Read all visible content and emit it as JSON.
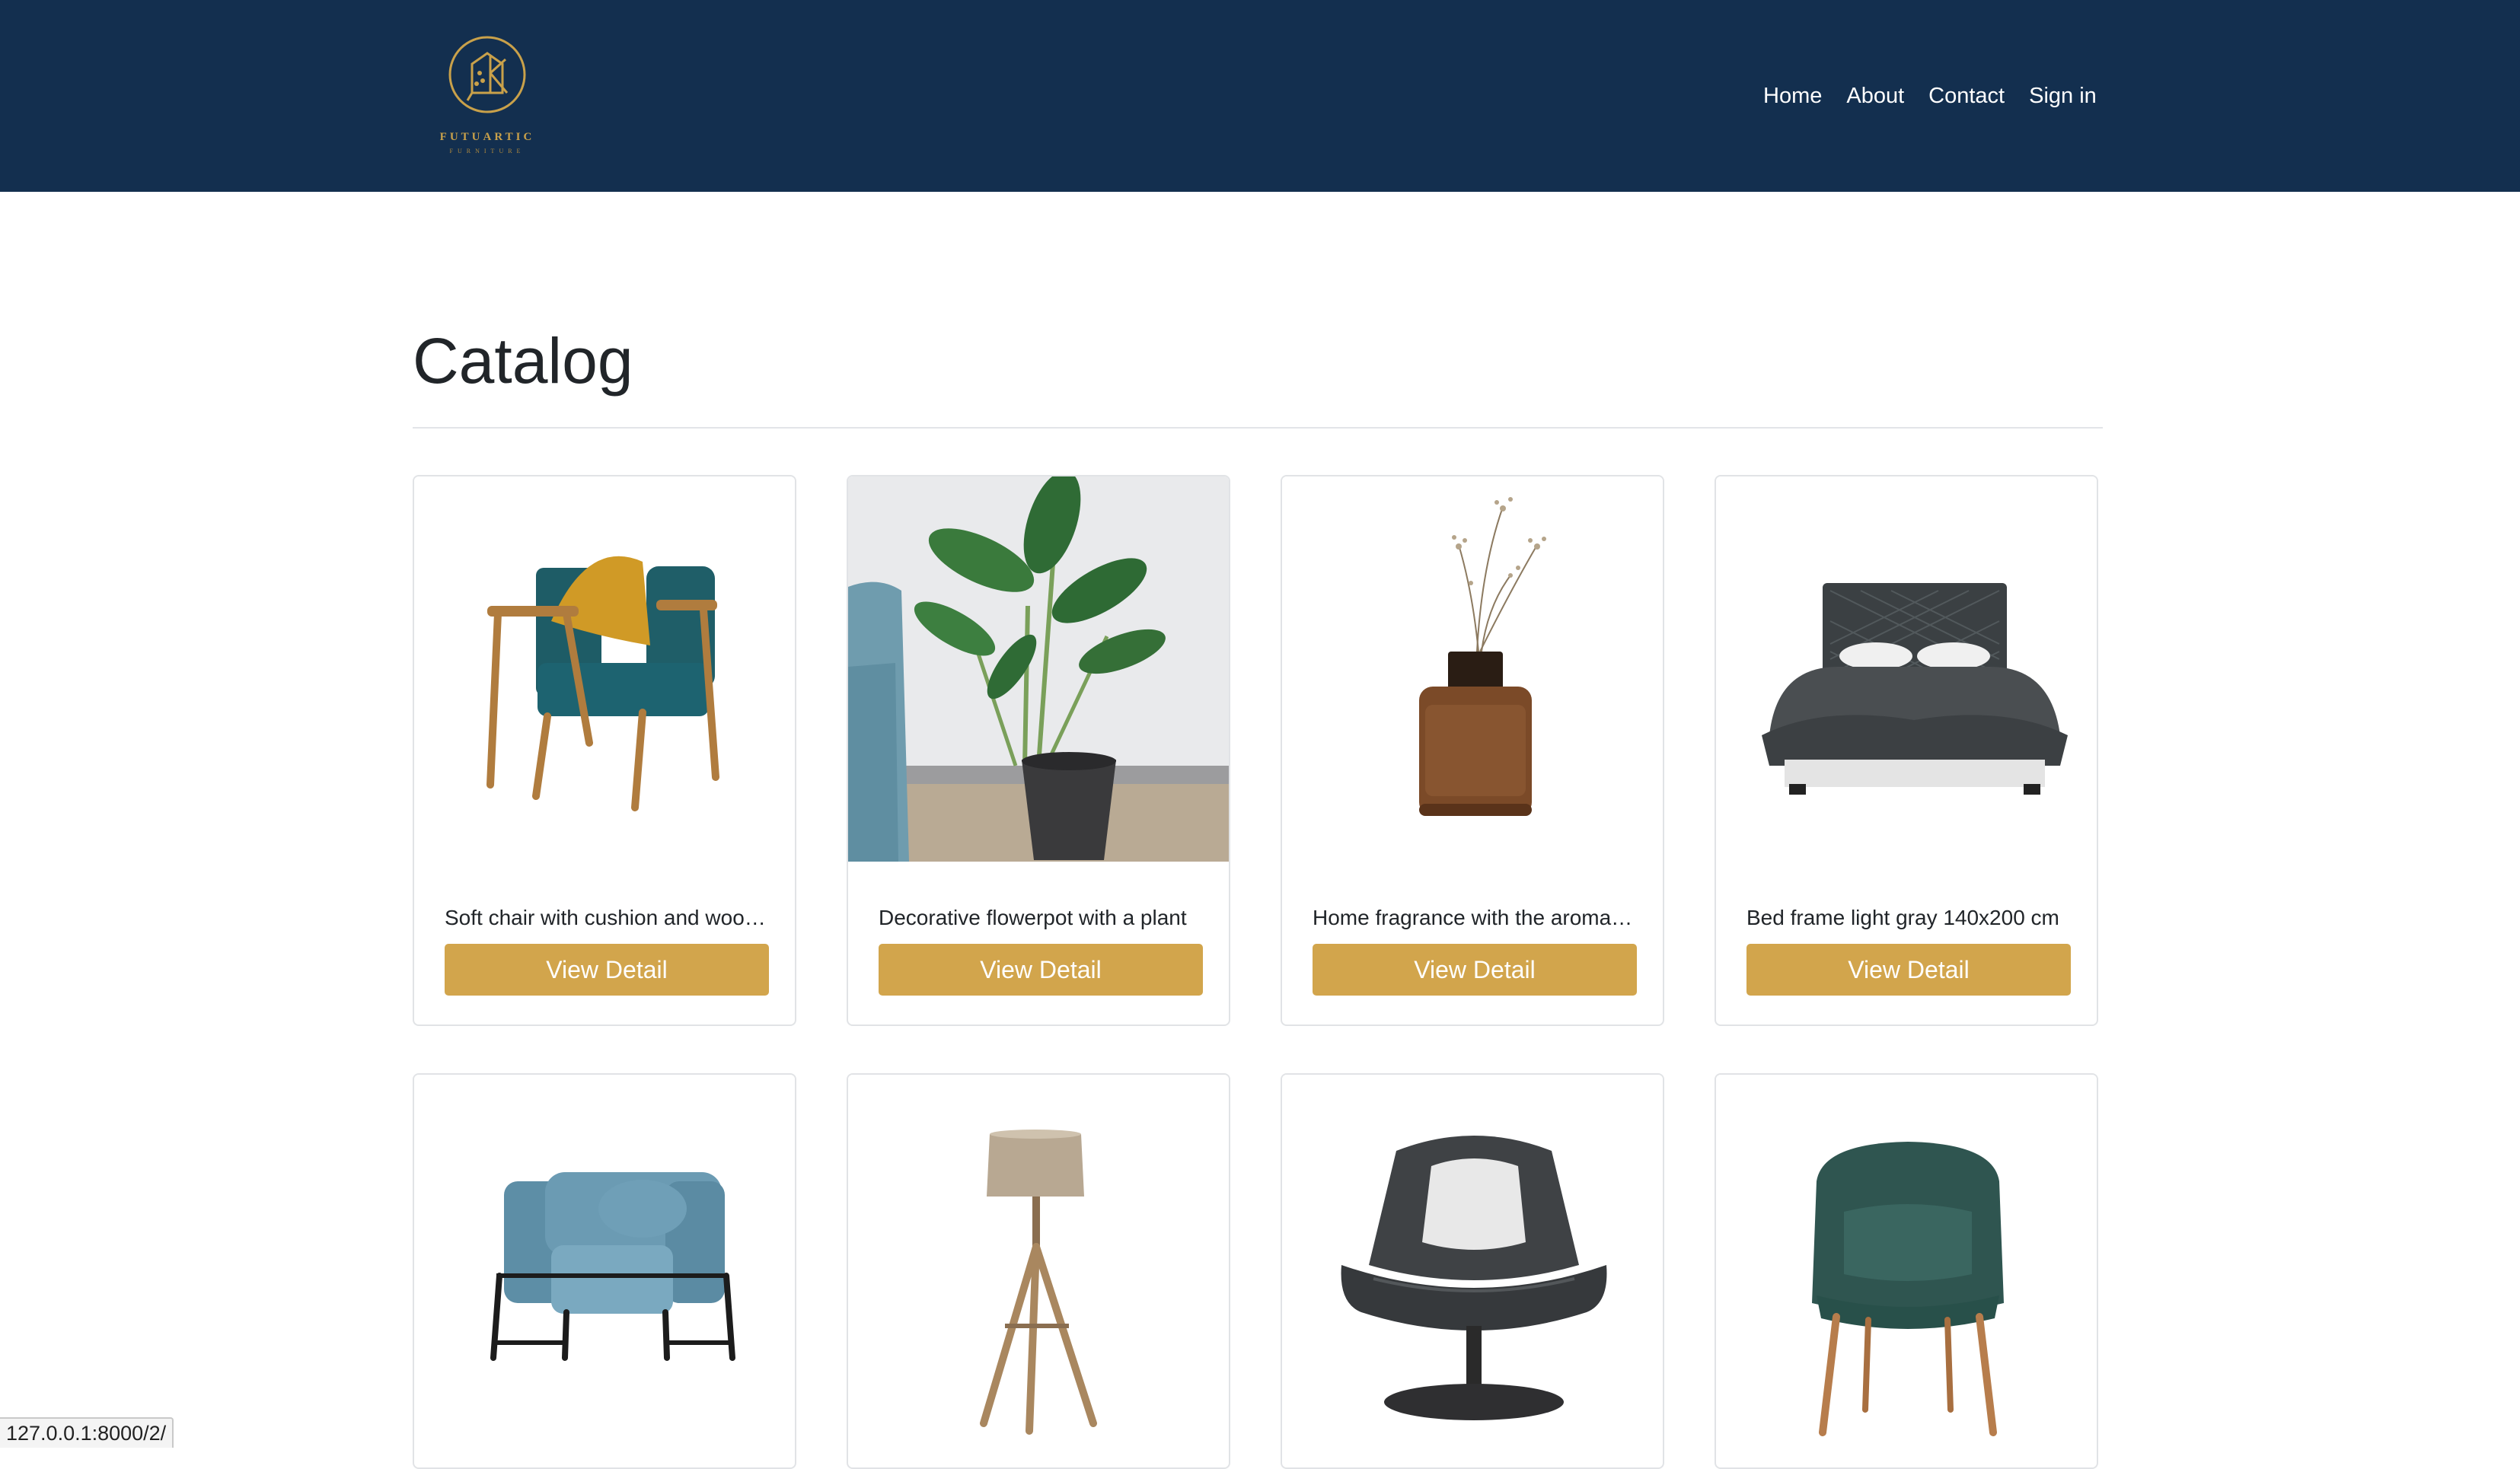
{
  "header": {
    "brand": "FUTUARTIC",
    "brand_sub": "FURNITURE",
    "nav": [
      "Home",
      "About",
      "Contact",
      "Sign in"
    ]
  },
  "main": {
    "title": "Catalog",
    "button_label": "View Detail",
    "products": [
      {
        "name": "Soft chair with cushion and woo…",
        "image": "armchair-teal-cushion"
      },
      {
        "name": "Decorative flowerpot with a plant",
        "image": "potted-plant"
      },
      {
        "name": "Home fragrance with the aroma…",
        "image": "fragrance-bottle"
      },
      {
        "name": "Bed frame light gray 140x200 cm",
        "image": "bed-frame"
      },
      {
        "name": "",
        "image": "blue-armchair"
      },
      {
        "name": "",
        "image": "tripod-floor-lamp"
      },
      {
        "name": "",
        "image": "swivel-lounge-chair"
      },
      {
        "name": "",
        "image": "green-dining-chair"
      }
    ]
  },
  "status_bar": {
    "url": "127.0.0.1:8000/2/"
  },
  "colors": {
    "header_bg": "#132f4f",
    "accent": "#d2a54c"
  }
}
